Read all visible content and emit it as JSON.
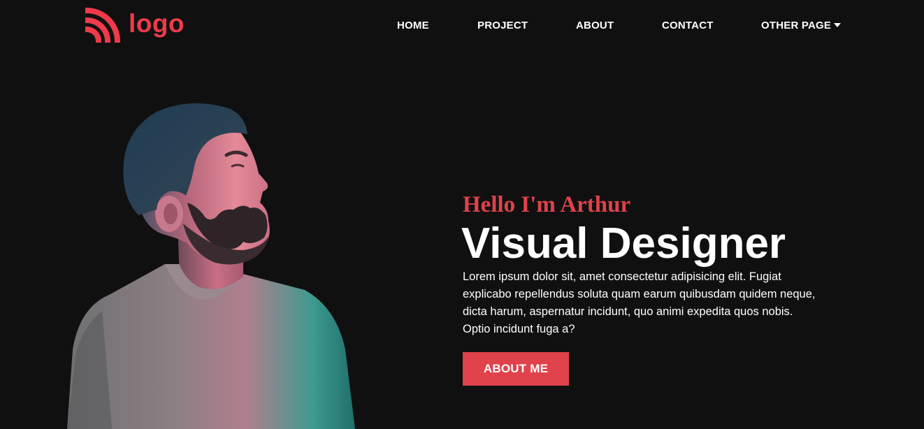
{
  "brand": {
    "logo_text": "logo",
    "accent_color": "#ee3a4a",
    "logo_icon": "wifi-arcs-icon"
  },
  "nav": {
    "items": [
      {
        "label": "HOME"
      },
      {
        "label": "PROJECT"
      },
      {
        "label": "ABOUT"
      },
      {
        "label": "CONTACT"
      },
      {
        "label": "OTHER PAGE",
        "icon": "caret-down-icon"
      }
    ]
  },
  "hero": {
    "greeting": "Hello I'm Arthur",
    "headline": "Visual Designer",
    "description": "Lorem ipsum dolor sit, amet consectetur adipisicing elit. Fugiat explicabo repellendus soluta quam earum quibusdam quidem neque, dicta harum, aspernatur incidunt, quo animi expedita quos nobis. Optio incidunt fuga a?",
    "button_label": "ABOUT ME",
    "button_color": "#e0424b",
    "photo": "bearded-man-portrait"
  },
  "theme": {
    "background": "#101010",
    "text": "#ffffff"
  }
}
